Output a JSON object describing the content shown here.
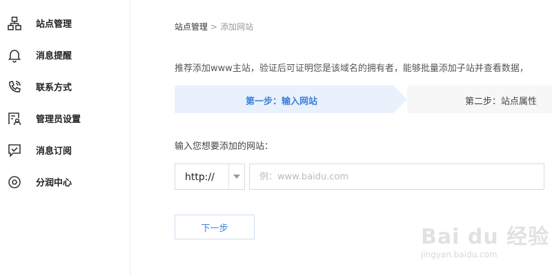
{
  "sidebar": {
    "items": [
      {
        "label": "站点管理",
        "icon": "site-manage-icon"
      },
      {
        "label": "消息提醒",
        "icon": "bell-icon"
      },
      {
        "label": "联系方式",
        "icon": "phone-icon"
      },
      {
        "label": "管理员设置",
        "icon": "admin-icon"
      },
      {
        "label": "消息订阅",
        "icon": "subscribe-icon"
      },
      {
        "label": "分润中心",
        "icon": "revenue-icon"
      }
    ]
  },
  "breadcrumb": {
    "root": "站点管理",
    "separator": ">",
    "current": "添加网站"
  },
  "intro_text": "推荐添加www主站，验证后可证明您是该域名的拥有者，能够批量添加子站并查看数据，",
  "steps": [
    {
      "label": "第一步：输入网站",
      "active": true
    },
    {
      "label": "第二步：站点属性",
      "active": false
    }
  ],
  "form": {
    "field_label": "输入您想要添加的网站：",
    "protocol_value": "http://",
    "url_placeholder": "例：www.baidu.com",
    "url_value": "",
    "next_label": "下一步"
  },
  "watermark": {
    "text": "Bai du 经验",
    "sub": "jingyan.baidu.com"
  },
  "colors": {
    "accent": "#3d7fd9",
    "step_active_bg": "#e9f1fd",
    "border": "#d9d9d9"
  }
}
